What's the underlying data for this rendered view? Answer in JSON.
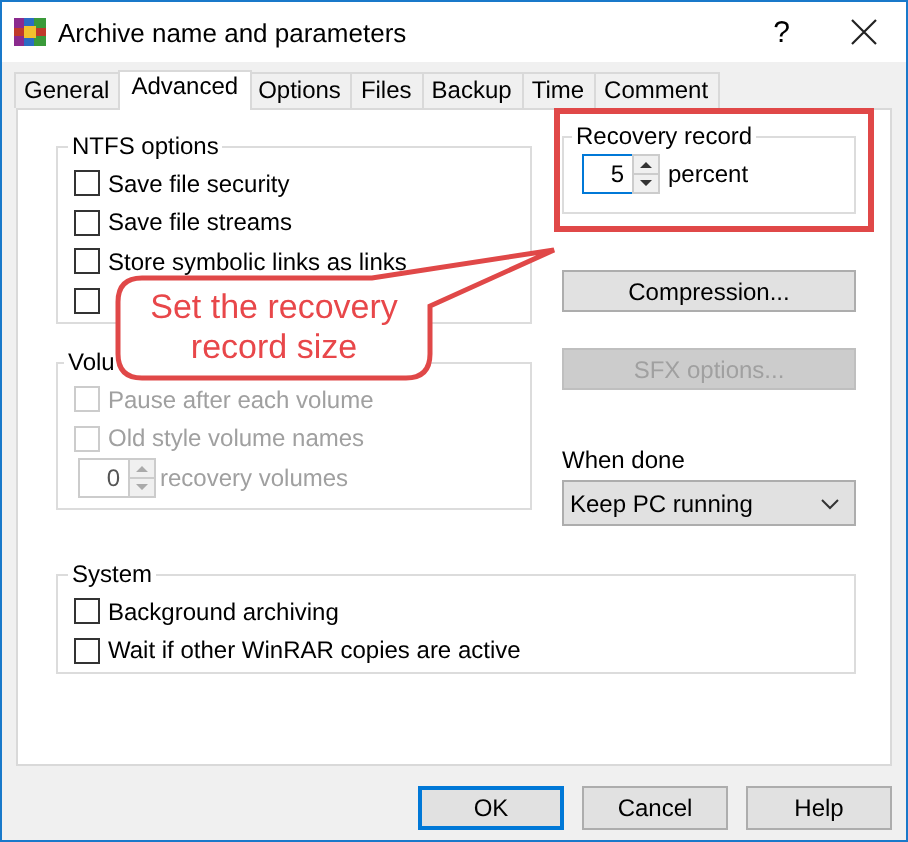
{
  "window": {
    "title": "Archive name and parameters",
    "help_button": "?"
  },
  "tabs": [
    {
      "label": "General",
      "selected": false
    },
    {
      "label": "Advanced",
      "selected": true
    },
    {
      "label": "Options",
      "selected": false
    },
    {
      "label": "Files",
      "selected": false
    },
    {
      "label": "Backup",
      "selected": false
    },
    {
      "label": "Time",
      "selected": false
    },
    {
      "label": "Comment",
      "selected": false
    }
  ],
  "ntfs_options": {
    "title": "NTFS options",
    "items": [
      {
        "kind": "checkbox",
        "label": "Save file security",
        "checked": false,
        "disabled": false
      },
      {
        "kind": "checkbox",
        "label": "Save file streams",
        "checked": false,
        "disabled": false
      },
      {
        "kind": "checkbox",
        "label": "Store symbolic links as links",
        "checked": false,
        "disabled": false
      },
      {
        "kind": "checkbox",
        "checked": false,
        "disabled": false
      }
    ]
  },
  "volume_options": {
    "title": "Volu",
    "items": [
      {
        "kind": "checkbox",
        "label": "Pause after each volume",
        "checked": false,
        "disabled": true
      },
      {
        "kind": "checkbox",
        "label": "Old style volume names",
        "checked": false,
        "disabled": true
      },
      {
        "kind": "spin",
        "value": "0",
        "unit": "recovery volumes",
        "disabled": true
      }
    ]
  },
  "recovery_record": {
    "title": "Recovery record",
    "value": "5",
    "unit": "percent"
  },
  "side_buttons": [
    {
      "label": "Compression...",
      "disabled": false
    },
    {
      "label": "SFX options...",
      "disabled": true
    }
  ],
  "when_done": {
    "label": "When done",
    "value": "Keep PC running"
  },
  "system": {
    "title": "System",
    "items": [
      {
        "kind": "checkbox",
        "label": "Background archiving",
        "checked": false,
        "disabled": false
      },
      {
        "kind": "checkbox",
        "label": "Wait if other WinRAR copies are active",
        "checked": false,
        "disabled": false
      }
    ]
  },
  "dialog_buttons": [
    {
      "label": "OK",
      "default": true
    },
    {
      "label": "Cancel",
      "default": false
    },
    {
      "label": "Help",
      "default": false
    }
  ],
  "callout": {
    "text": "Set the recovery record size"
  }
}
